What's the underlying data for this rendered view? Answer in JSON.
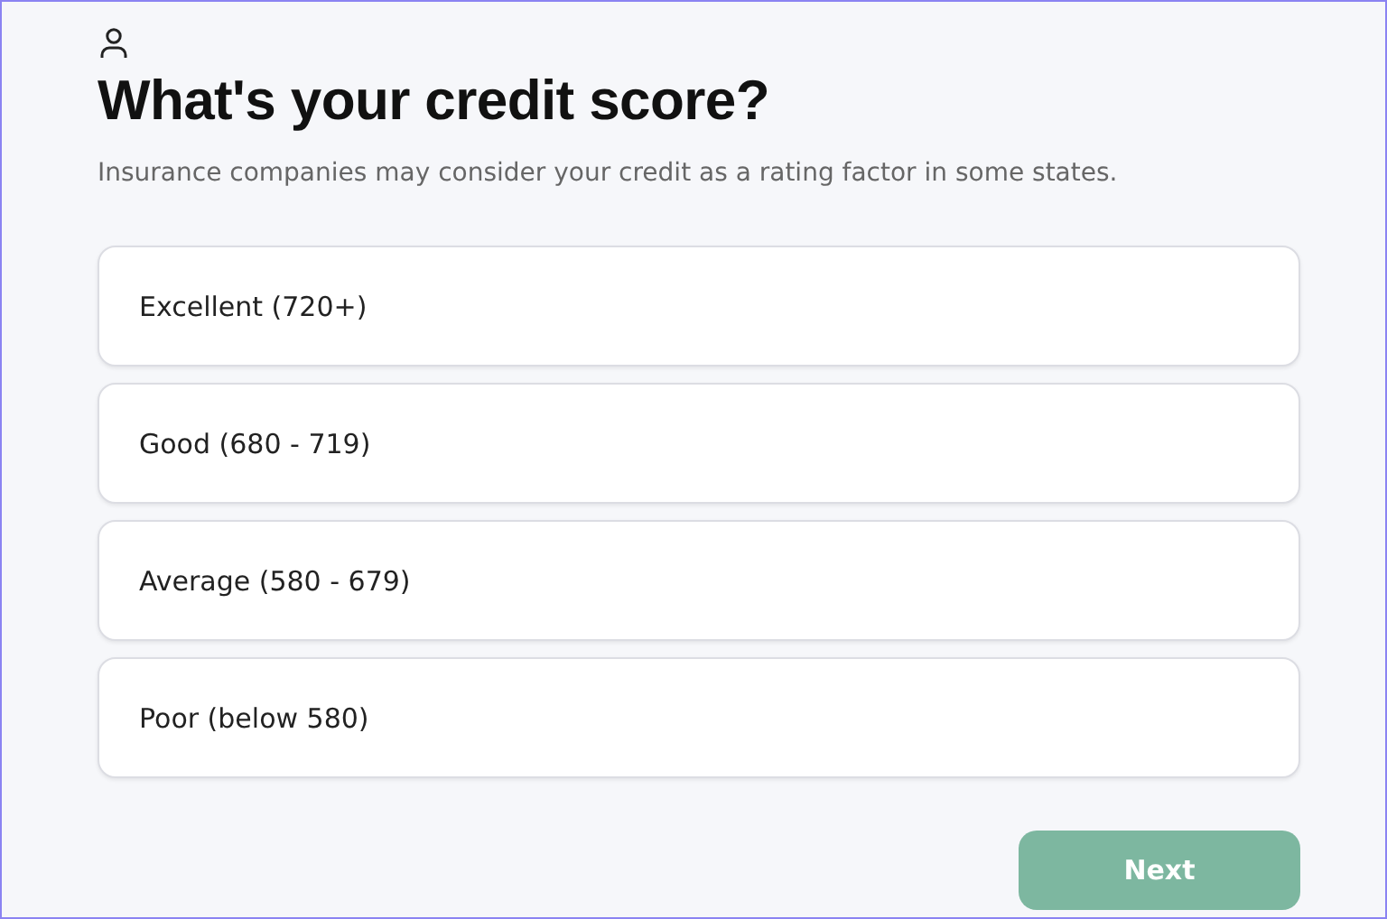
{
  "title": "What's your credit score?",
  "subtitle": "Insurance companies may consider your credit as a rating factor in some states.",
  "options": [
    {
      "label": "Excellent (720+)",
      "selected": false
    },
    {
      "label": "Good (680 - 719)",
      "selected": false
    },
    {
      "label": "Average (580 - 679)",
      "selected": false
    },
    {
      "label": "Poor (below 580)",
      "selected": false
    }
  ],
  "next_button": {
    "label": "Next",
    "disabled": true
  }
}
